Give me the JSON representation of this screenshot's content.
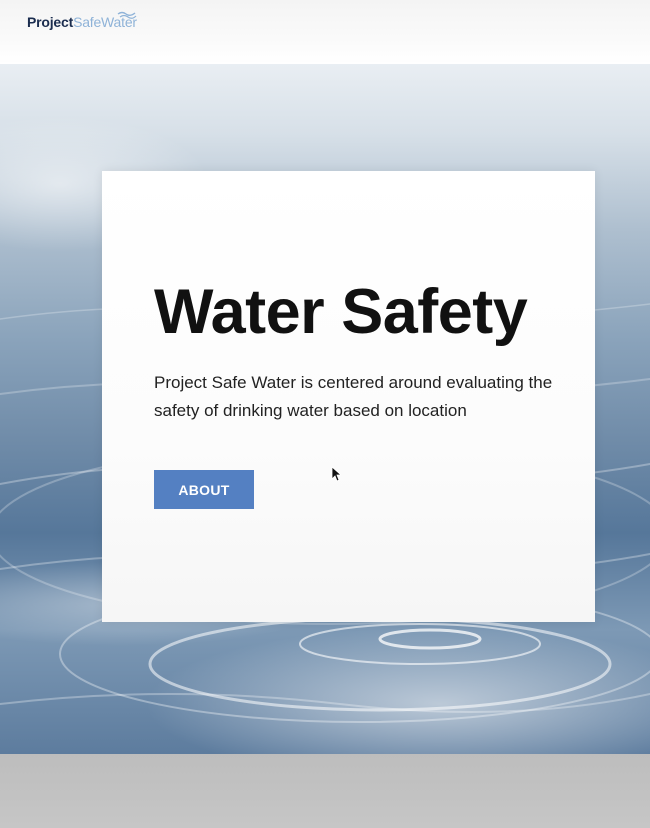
{
  "header": {
    "logo": {
      "part1": "Project",
      "part2": "SafeWater",
      "icon": "wave-icon"
    }
  },
  "hero": {
    "background_image": "water-ripple-image",
    "card": {
      "title": "Water Safety",
      "description": "Project Safe Water is centered around evaluating the safety of drinking water based on location",
      "button_label": "ABOUT"
    }
  },
  "colors": {
    "brand_dark": "#1b2d4f",
    "brand_light": "#8fb3d8",
    "button": "#5480c2",
    "title": "#111111"
  },
  "cursor_icon": "mouse-pointer-icon"
}
